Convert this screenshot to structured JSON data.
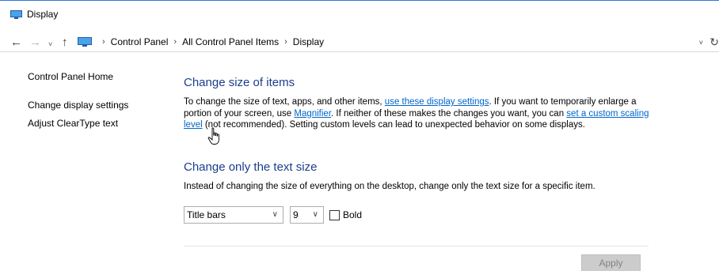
{
  "window": {
    "title": "Display"
  },
  "nav": {
    "back": "←",
    "forward": "→",
    "recent": "˅",
    "up": "↑"
  },
  "breadcrumb": {
    "items": [
      "Control Panel",
      "All Control Panel Items",
      "Display"
    ],
    "separator": "›",
    "dropdown": "˅",
    "refresh": "↻"
  },
  "sidebar": {
    "items": [
      {
        "label": "Control Panel Home"
      },
      {
        "label": "Change display settings"
      },
      {
        "label": "Adjust ClearType text"
      }
    ]
  },
  "section1": {
    "heading": "Change size of items",
    "text_1": "To change the size of text, apps, and other items, ",
    "link_1": "use these display settings",
    "text_2": ".  If you want to temporarily enlarge a portion of your screen, use ",
    "link_2": "Magnifier",
    "text_3": ".  If neither of these makes the changes you want, you can ",
    "link_3": "set a custom scaling level",
    "text_4": " (not recommended).  Setting custom levels can lead to unexpected behavior on some displays."
  },
  "section2": {
    "heading": "Change only the text size",
    "text": "Instead of changing the size of everything on the desktop, change only the text size for a specific item.",
    "item_select": {
      "value": "Title bars"
    },
    "size_select": {
      "value": "9"
    },
    "bold_label": "Bold",
    "bold_checked": false
  },
  "footer": {
    "apply_label": "Apply"
  },
  "colors": {
    "heading": "#1a3e8c",
    "link": "#0066cc",
    "title_border": "#2b79d8"
  }
}
